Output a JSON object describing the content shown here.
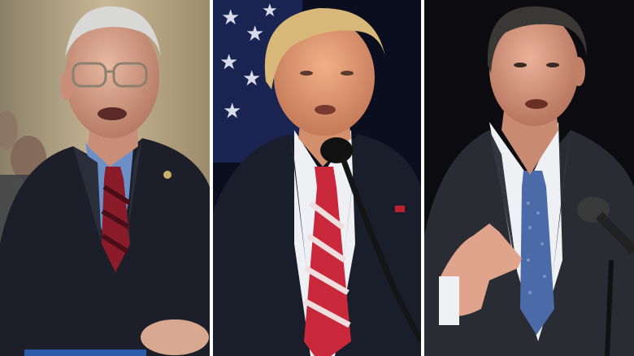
{
  "image": {
    "layout": "three-panel-photo-collage",
    "panels": [
      {
        "subject": "older-man-glasses-speaking",
        "tie_color": "#8a1c2a",
        "background": "#b5a483"
      },
      {
        "subject": "man-blond-hair-at-microphone",
        "tie_color": "#c8283a",
        "background": "#0a0e1e"
      },
      {
        "subject": "gray-haired-man-gesturing-at-microphone",
        "tie_color": "#4a6aa8",
        "background": "#0c0c10"
      }
    ],
    "colors": {
      "divider": "#ffffff",
      "suit_dark": "#1c1f29",
      "shirt_blue": "#6d8fc8",
      "shirt_white": "#eef0f4"
    }
  }
}
